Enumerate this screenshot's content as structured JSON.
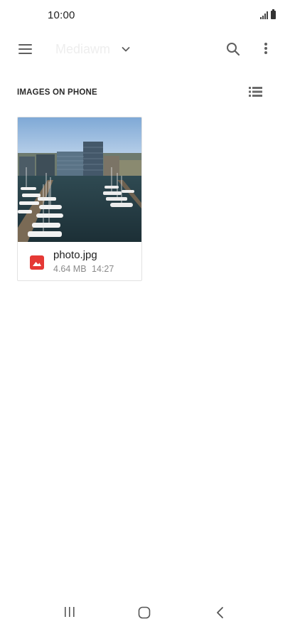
{
  "status_bar": {
    "time": "10:00",
    "signal_icon": "signal-bars-icon",
    "battery_icon": "battery-icon"
  },
  "app_bar": {
    "menu_icon": "hamburger-menu-icon",
    "title": "Mediawm",
    "dropdown_icon": "chevron-down-icon",
    "search_icon": "search-icon",
    "more_icon": "more-vert-icon"
  },
  "section": {
    "header": "IMAGES ON PHONE",
    "view_toggle_icon": "list-view-icon"
  },
  "files": [
    {
      "name": "photo.jpg",
      "size": "4.64 MB",
      "time": "14:27",
      "type_icon": "image-file-icon",
      "thumbnail": "harbor-marina-photo"
    }
  ],
  "navigation_bar": {
    "recents_icon": "recent-apps-icon",
    "home_icon": "home-icon",
    "back_icon": "back-icon"
  },
  "colors": {
    "accent_red": "#e53935",
    "text_primary": "#212121",
    "text_secondary": "#8a8a8a",
    "icon_gray": "#5f5f5f",
    "title_faded": "#eeeeee"
  }
}
